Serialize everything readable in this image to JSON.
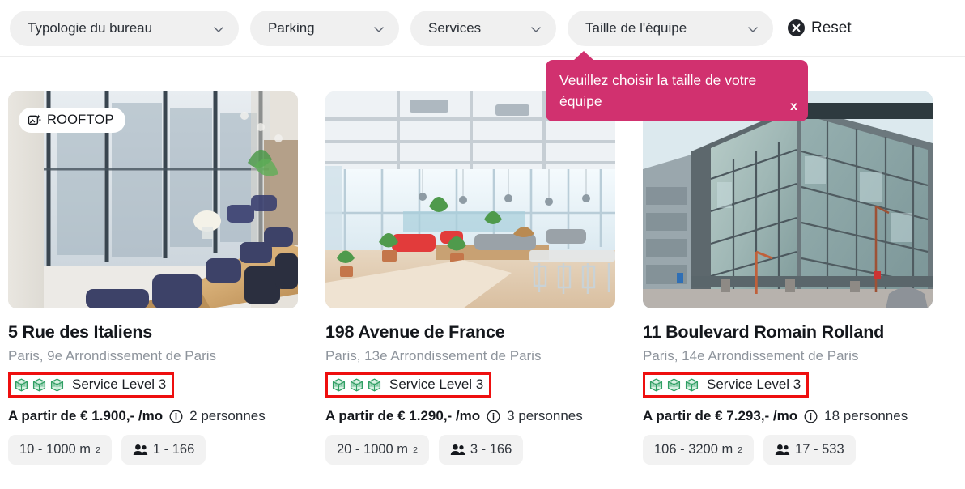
{
  "filters": {
    "chips": [
      {
        "label": "Typologie du bureau",
        "icon": "chevron-down-icon"
      },
      {
        "label": "Parking",
        "icon": "chevron-down-icon"
      },
      {
        "label": "Services",
        "icon": "chevron-down-icon"
      },
      {
        "label": "Taille de l'équipe",
        "icon": "chevron-down-icon"
      }
    ],
    "reset": {
      "label": "Reset",
      "icon": "close-circle-icon"
    }
  },
  "tooltip": {
    "message": "Veuillez choisir la taille de votre équipe",
    "close_label": "x",
    "color": "#d1316f"
  },
  "colors": {
    "accent_pink": "#d1316f",
    "highlight_red": "#ee0f0f",
    "service_green": "#3aa76d",
    "chip_grey": "#f0f0f0"
  },
  "cards": [
    {
      "badge": {
        "label": "ROOFTOP",
        "icon": "image-sparkle-icon"
      },
      "title": "5 Rue des Italiens",
      "location": "Paris, 9e Arrondissement de Paris",
      "service_level": {
        "label": "Service Level 3",
        "cubes": 3,
        "icon": "cube-icon"
      },
      "price": "A partir de € 1.900,- /mo",
      "info_icon": "info-icon",
      "people": "2 personnes",
      "area_chip": {
        "value": "10 - 1000 m",
        "unit": "2"
      },
      "capacity_chip": {
        "value": "1 - 166",
        "icon": "people-icon"
      },
      "image": "rooftop-meeting-room-long-wooden-table-navy-chairs"
    },
    {
      "badge": null,
      "title": "198 Avenue de France",
      "location": "Paris, 13e Arrondissement de Paris",
      "service_level": {
        "label": "Service Level 3",
        "cubes": 3,
        "icon": "cube-icon"
      },
      "price": "A partir de € 1.290,- /mo",
      "info_icon": "info-icon",
      "people": "3 personnes",
      "area_chip": {
        "value": "20 - 1000 m",
        "unit": "2"
      },
      "capacity_chip": {
        "value": "3 - 166",
        "icon": "people-icon"
      },
      "image": "bright-open-plan-office-plants-red-chairs"
    },
    {
      "badge": null,
      "title": "11 Boulevard Romain Rolland",
      "location": "Paris, 14e Arrondissement de Paris",
      "service_level": {
        "label": "Service Level 3",
        "cubes": 3,
        "icon": "cube-icon"
      },
      "price": "A partir de € 7.293,- /mo",
      "info_icon": "info-icon",
      "people": "18 personnes",
      "area_chip": {
        "value": "106 - 3200 m",
        "unit": "2"
      },
      "capacity_chip": {
        "value": "17 - 533",
        "icon": "people-icon"
      },
      "image": "modern-glass-office-building-exterior"
    }
  ]
}
